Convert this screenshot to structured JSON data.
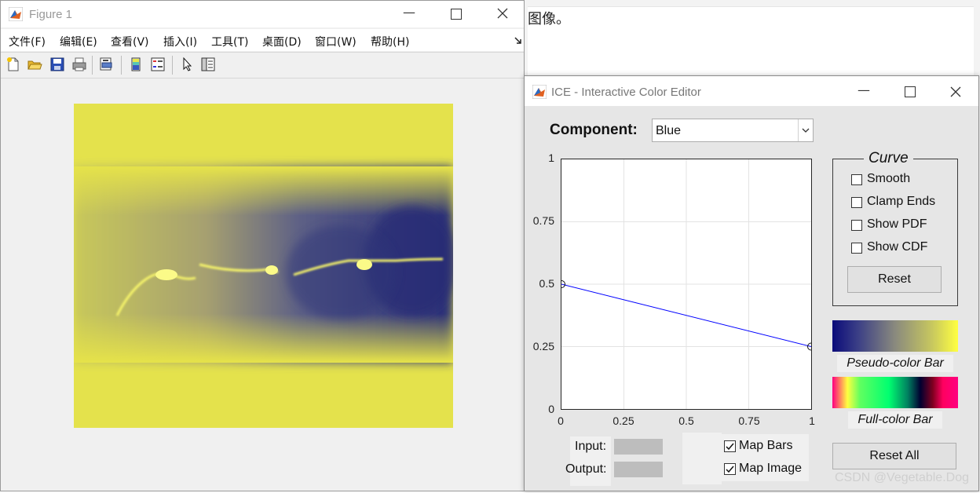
{
  "background_doc": {
    "text": "图像。"
  },
  "figure_window": {
    "title": "Figure 1",
    "menu": [
      "文件(F)",
      "编辑(E)",
      "查看(V)",
      "插入(I)",
      "工具(T)",
      "桌面(D)",
      "窗口(W)",
      "帮助(H)"
    ],
    "toolbar_icons": [
      "new-file-icon",
      "open-folder-icon",
      "save-icon",
      "print-icon",
      "print-preview-icon",
      "colorbar-icon",
      "legend-icon",
      "pointer-icon",
      "property-inspector-icon"
    ]
  },
  "ice_window": {
    "title": "ICE - Interactive Color Editor",
    "component_label": "Component:",
    "component_value": "Blue",
    "curve_group": {
      "title": "Curve",
      "options": [
        {
          "label": "Smooth",
          "checked": false
        },
        {
          "label": "Clamp Ends",
          "checked": false
        },
        {
          "label": "Show PDF",
          "checked": false
        },
        {
          "label": "Show CDF",
          "checked": false
        }
      ],
      "reset_label": "Reset"
    },
    "pseudo_bar_label": "Pseudo-color Bar",
    "full_bar_label": "Full-color Bar",
    "input_label": "Input:",
    "output_label": "Output:",
    "map_bars": {
      "label": "Map Bars",
      "checked": true
    },
    "map_image": {
      "label": "Map Image",
      "checked": true
    },
    "reset_all_label": "Reset All",
    "colors": {
      "curve": "#0000ff",
      "pseudo_start": "#0b0b7a",
      "pseudo_end": "#ffff40"
    }
  },
  "chart_data": {
    "type": "line",
    "x": [
      0,
      1
    ],
    "y": [
      0.5,
      0.25
    ],
    "xlim": [
      0,
      1
    ],
    "ylim": [
      0,
      1
    ],
    "xticks": [
      "0",
      "0.25",
      "0.5",
      "0.75",
      "1"
    ],
    "yticks": [
      "0",
      "0.25",
      "0.5",
      "0.75",
      "1"
    ],
    "grid": true
  },
  "watermark": "CSDN @Vegetable.Dog"
}
